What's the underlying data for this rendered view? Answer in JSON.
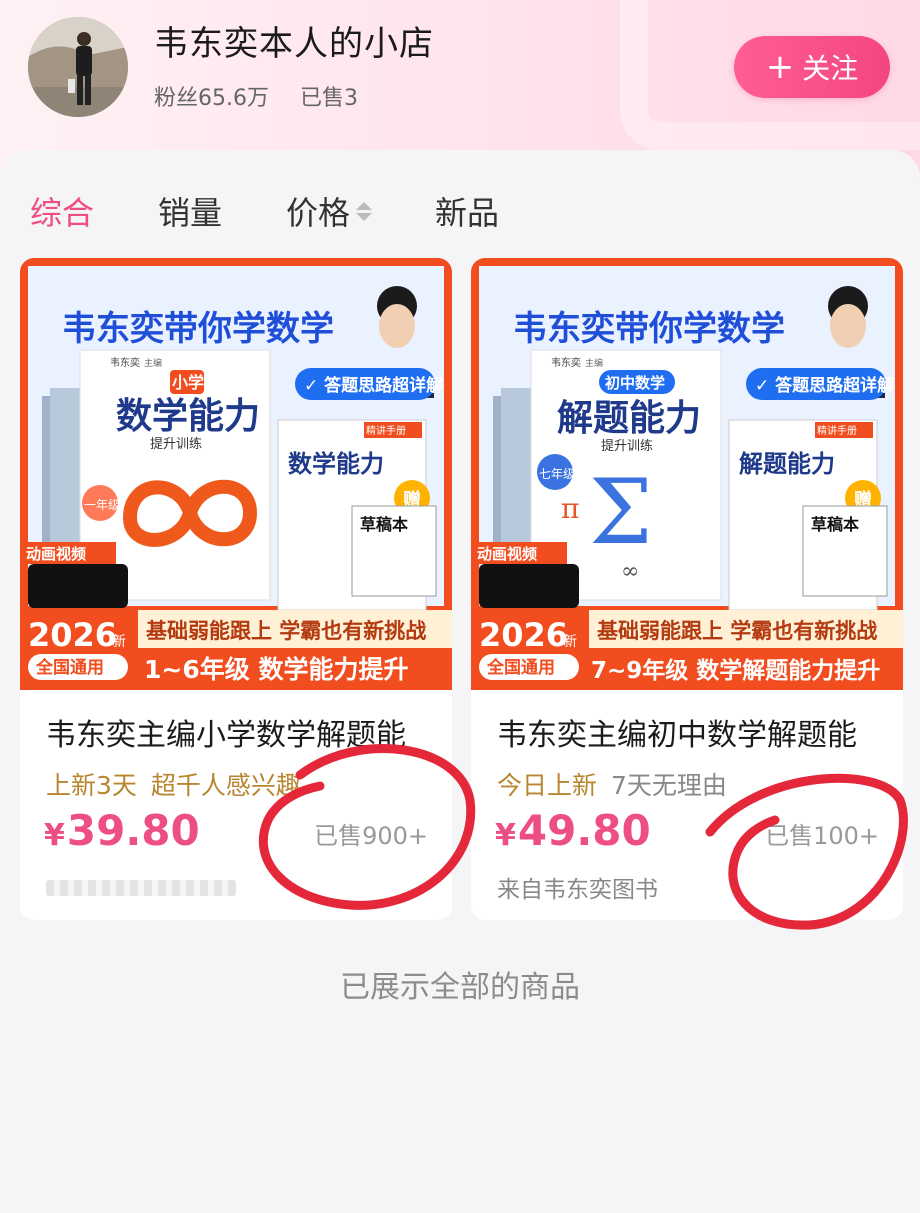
{
  "shop": {
    "name": "韦东奕本人的小店",
    "fans": "粉丝65.6万",
    "sold": "已售3",
    "follow_label": "关注"
  },
  "sort_tabs": {
    "comprehensive": "综合",
    "sales": "销量",
    "price": "价格",
    "new": "新品"
  },
  "products": [
    {
      "title": "韦东奕主编小学数学解题能",
      "tag1": "上新3天",
      "tag2": "超千人感兴趣",
      "price": "39.80",
      "currency": "¥",
      "sold": "已售900+",
      "cover": {
        "banner": "韦东奕带你学数学",
        "badge": "答题思路超详解",
        "stage": "小学",
        "book_title": "数学能力",
        "book_sub": "提升训练",
        "grade": "一年级",
        "gift": "赠",
        "draft": "草稿本",
        "video": "动画视频",
        "year": "2026",
        "new": "新",
        "national": "全国通用",
        "slogan1": "基础弱能跟上 学霸也有新挑战",
        "slogan2": "1~6年级 数学能力提升",
        "editor": "韦东奕",
        "editor_role": "主编",
        "manual": "精讲手册"
      }
    },
    {
      "title": "韦东奕主编初中数学解题能",
      "tag1": "今日上新",
      "tag2": "7天无理由",
      "price": "49.80",
      "currency": "¥",
      "sold": "已售100+",
      "source": "来自韦东奕图书",
      "cover": {
        "banner": "韦东奕带你学数学",
        "badge": "答题思路超详解",
        "stage": "初中数学",
        "book_title": "解题能力",
        "book_sub": "提升训练",
        "grade": "七年级",
        "gift": "赠",
        "draft": "草稿本",
        "video": "动画视频",
        "year": "2026",
        "new": "新",
        "national": "全国通用",
        "slogan1": "基础弱能跟上 学霸也有新挑战",
        "slogan2": "7~9年级 数学解题能力提升",
        "editor": "韦东奕",
        "editor_role": "主编",
        "manual": "精讲手册"
      }
    }
  ],
  "footer": {
    "end_text": "已展示全部的商品"
  },
  "colors": {
    "accent": "#ee4e86",
    "cover_orange": "#f24d1e",
    "gold": "#b8862e",
    "annotation": "#e5273a"
  }
}
